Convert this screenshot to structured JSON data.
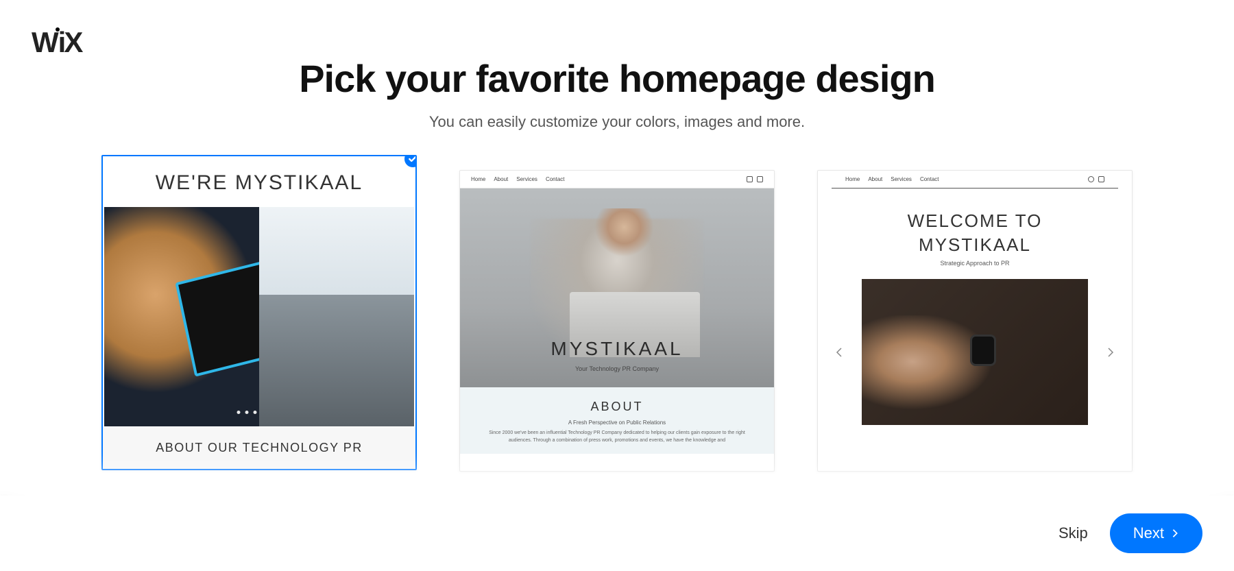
{
  "logo_text": "WiX",
  "heading": {
    "title": "Pick your favorite homepage design",
    "subtitle": "You can easily customize your colors, images and more."
  },
  "templates": {
    "t1": {
      "selected": true,
      "hero_title": "WE'RE MYSTIKAAL",
      "footer_text": "ABOUT OUR TECHNOLOGY PR"
    },
    "t2": {
      "nav": {
        "items": [
          "Home",
          "About",
          "Services",
          "Contact"
        ]
      },
      "brand": "MYSTIKAAL",
      "brand_sub": "Your Technology PR Company",
      "about_heading": "ABOUT",
      "about_tagline": "A Fresh Perspective on Public Relations",
      "about_body": "Since 2000 we've been an influential Technology PR Company dedicated to helping our clients gain exposure to the right audiences. Through a combination of press work, promotions and events, we have the knowledge and"
    },
    "t3": {
      "nav": {
        "items": [
          "Home",
          "About",
          "Services",
          "Contact"
        ]
      },
      "title_line1": "WELCOME TO",
      "title_line2": "MYSTIKAAL",
      "subtitle": "Strategic Approach to PR"
    }
  },
  "footer": {
    "skip": "Skip",
    "next": "Next"
  },
  "colors": {
    "accent": "#0077ff"
  }
}
